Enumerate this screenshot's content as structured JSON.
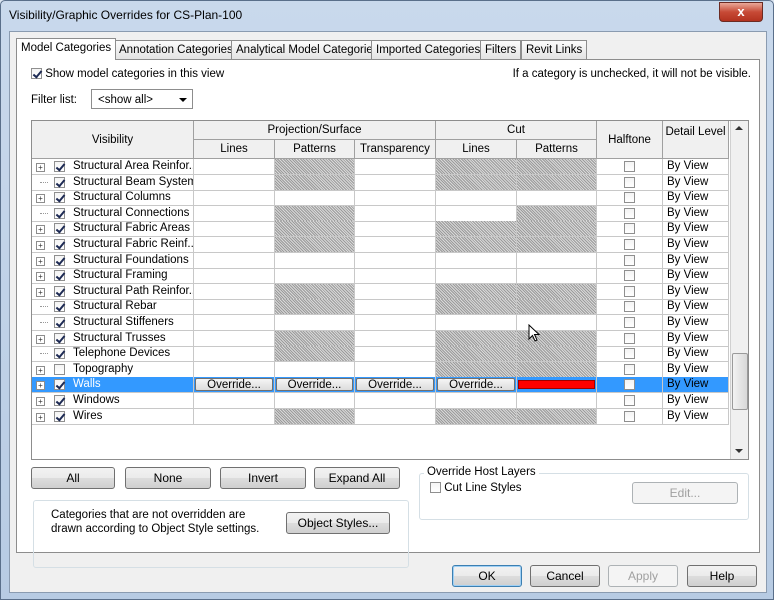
{
  "window": {
    "title": "Visibility/Graphic Overrides for CS-Plan-100",
    "close_glyph": "x"
  },
  "tabs": [
    {
      "label": "Model Categories",
      "active": true
    },
    {
      "label": "Annotation Categories"
    },
    {
      "label": "Analytical Model Categories"
    },
    {
      "label": "Imported Categories"
    },
    {
      "label": "Filters"
    },
    {
      "label": "Revit Links"
    }
  ],
  "top": {
    "show_label": "Show model categories in this view",
    "show_checked": true,
    "info": "If a category is unchecked, it will not be visible.",
    "filter_label": "Filter list:",
    "filter_value": "<show all>"
  },
  "headers": {
    "visibility": "Visibility",
    "projection": "Projection/Surface",
    "cut": "Cut",
    "halftone": "Halftone",
    "detail_level": "Detail Level",
    "lines": "Lines",
    "patterns": "Patterns",
    "transparency": "Transparency",
    "cut_lines": "Lines",
    "cut_patterns": "Patterns"
  },
  "rows": [
    {
      "name": "Structural Area Reinfor...",
      "checked": true,
      "expandable": true,
      "detail": "By View",
      "hatch": [
        false,
        true,
        false,
        true,
        true
      ]
    },
    {
      "name": "Structural Beam Systems",
      "checked": true,
      "expandable": false,
      "detail": "By View",
      "hatch": [
        false,
        true,
        false,
        true,
        true
      ]
    },
    {
      "name": "Structural Columns",
      "checked": true,
      "expandable": true,
      "detail": "By View",
      "hatch": [
        false,
        false,
        false,
        false,
        false
      ]
    },
    {
      "name": "Structural Connections",
      "checked": true,
      "expandable": false,
      "detail": "By View",
      "hatch": [
        false,
        true,
        false,
        false,
        true
      ]
    },
    {
      "name": "Structural Fabric Areas",
      "checked": true,
      "expandable": true,
      "detail": "By View",
      "hatch": [
        false,
        true,
        false,
        true,
        true
      ]
    },
    {
      "name": "Structural Fabric Reinf...",
      "checked": true,
      "expandable": true,
      "detail": "By View",
      "hatch": [
        false,
        true,
        false,
        true,
        true
      ]
    },
    {
      "name": "Structural Foundations",
      "checked": true,
      "expandable": true,
      "detail": "By View",
      "hatch": [
        false,
        false,
        false,
        false,
        false
      ]
    },
    {
      "name": "Structural Framing",
      "checked": true,
      "expandable": true,
      "detail": "By View",
      "hatch": [
        false,
        false,
        false,
        false,
        false
      ]
    },
    {
      "name": "Structural Path Reinfor...",
      "checked": true,
      "expandable": true,
      "detail": "By View",
      "hatch": [
        false,
        true,
        false,
        true,
        true
      ]
    },
    {
      "name": "Structural Rebar",
      "checked": true,
      "expandable": false,
      "detail": "By View",
      "hatch": [
        false,
        true,
        false,
        true,
        true
      ]
    },
    {
      "name": "Structural Stiffeners",
      "checked": true,
      "expandable": false,
      "detail": "By View",
      "hatch": [
        false,
        false,
        false,
        false,
        false
      ]
    },
    {
      "name": "Structural Trusses",
      "checked": true,
      "expandable": true,
      "detail": "By View",
      "hatch": [
        false,
        true,
        false,
        true,
        true
      ]
    },
    {
      "name": "Telephone Devices",
      "checked": true,
      "expandable": false,
      "detail": "By View",
      "hatch": [
        false,
        true,
        false,
        true,
        true
      ]
    },
    {
      "name": "Topography",
      "checked": false,
      "expandable": true,
      "detail": "By View",
      "hatch": [
        false,
        false,
        false,
        true,
        true
      ]
    },
    {
      "name": "Walls",
      "checked": true,
      "expandable": true,
      "detail": "By View",
      "selected": true,
      "overrides": [
        "Override...",
        "Override...",
        "Override...",
        "Override..."
      ],
      "cut_pattern_color": "#ff0000"
    },
    {
      "name": "Windows",
      "checked": true,
      "expandable": true,
      "detail": "By View",
      "hatch": [
        false,
        false,
        false,
        false,
        false
      ]
    },
    {
      "name": "Wires",
      "checked": true,
      "expandable": true,
      "detail": "By View",
      "hatch": [
        false,
        true,
        false,
        true,
        true
      ]
    }
  ],
  "buttons": {
    "all": "All",
    "none": "None",
    "invert": "Invert",
    "expand_all": "Expand All",
    "object_styles": "Object Styles...",
    "edit": "Edit..."
  },
  "note": "Categories that are not overridden are drawn according to Object Style settings.",
  "override_host": {
    "legend": "Override Host Layers",
    "cut_line_styles": "Cut Line Styles",
    "checked": false
  },
  "footer": {
    "ok": "OK",
    "cancel": "Cancel",
    "apply": "Apply",
    "help": "Help"
  },
  "colors": {
    "selection": "#3399ff",
    "override_red": "#ff0000"
  }
}
